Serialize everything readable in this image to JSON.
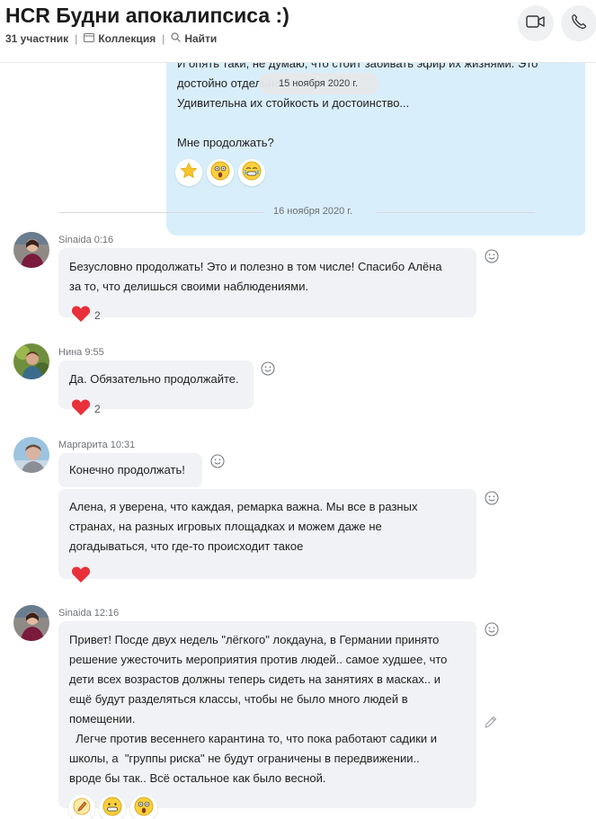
{
  "header": {
    "title": "HCR Будни апокалипсиса :)",
    "participants": "31 участник",
    "collection": "Коллекция",
    "search": "Найти"
  },
  "outgoing": {
    "lines": [
      "И опять таки, не думаю, что стоит забивать эфир их жизнями. Это",
      "достойно отдельного",
      "Удивительна их стойкость и достоинство...",
      "",
      "Мне продолжать?"
    ],
    "floating_date": "15 ноября 2020 г.",
    "reactions": [
      "star-emoji",
      "shocked-emoji",
      "crying-emoji"
    ]
  },
  "date_separator": "16 ноября 2020 г.",
  "messages": [
    {
      "sender": "Sinaida 0:16",
      "lines": [
        "Безусловно продолжать! Это и полезно в том числе! Спасибо Алёна",
        "за то, что делишься своими наблюдениями."
      ],
      "heart_count": "2"
    },
    {
      "sender": "Нина 9:55",
      "lines": [
        "Да. Обязательно продолжайте."
      ],
      "heart_count": "2"
    },
    {
      "sender": "Маргарита 10:31",
      "lines": [
        "Конечно продолжать!"
      ]
    },
    {
      "lines": [
        "Алена, я уверена, что каждая, ремарка важна. Мы все в разных",
        "странах, на разных игровых площадках и можем даже не",
        "догадываться, что где-то происходит такое"
      ]
    },
    {
      "sender": "Sinaida 12:16",
      "lines": [
        "Привет! Посде двух недель \"лёгкого\" локдауна, в Германии принято",
        "решение ужесточить мероприятия против людей.. самое худшее, что",
        "дети всех возрастов должны теперь сидеть на занятиях в масках.. и",
        "ещё будут разделяться классы, чтобы не было много людей в",
        "помещении.",
        "  Легче против весеннего карантина то, что пока работают садики и",
        "школы, а  \"группы риска\" не будут ограничены в передвижении..",
        "вроде бы так.. Всё остальное как было весной."
      ],
      "reactions": [
        "pencil-emoji",
        "grimace-emoji",
        "shocked-emoji"
      ]
    }
  ],
  "colors": {
    "outgoing_bubble": "#d9eefb",
    "incoming_bubble": "#f0f2f5",
    "heart": "#e8303a"
  }
}
